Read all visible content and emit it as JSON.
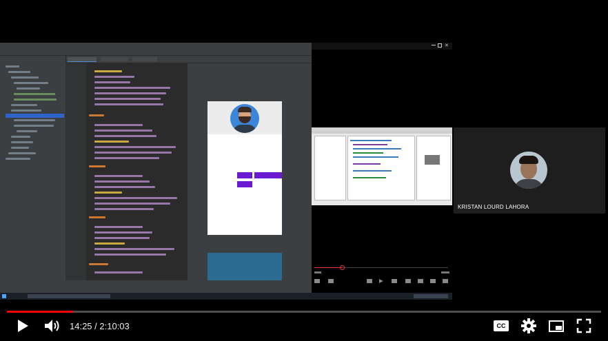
{
  "player": {
    "current_time": "14:25",
    "separator": " / ",
    "duration": "2:10:03",
    "progress_fraction": 0.1109,
    "accent_color": "#ff0000"
  },
  "participant": {
    "name": "KRISTAN LOURD LAHORA"
  },
  "controls": {
    "play": "play-icon",
    "volume": "volume-icon",
    "captions": "CC",
    "settings": "gear-icon",
    "miniplayer": "miniplayer-icon",
    "fullscreen": "fullscreen-icon"
  }
}
